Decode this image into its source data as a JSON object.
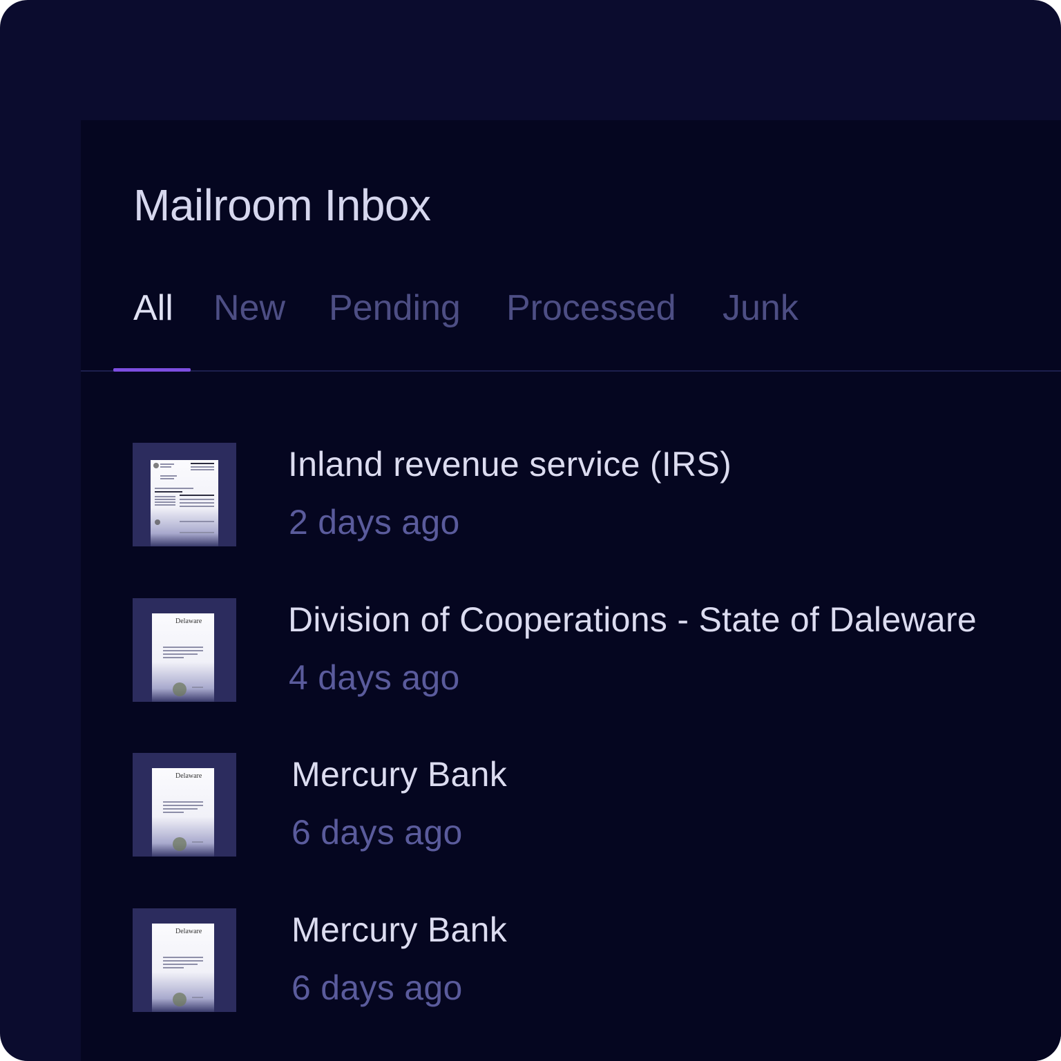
{
  "inbox": {
    "title": "Mailroom Inbox",
    "tabs": [
      {
        "label": "All",
        "active": true
      },
      {
        "label": "New",
        "active": false
      },
      {
        "label": "Pending",
        "active": false
      },
      {
        "label": "Processed",
        "active": false
      },
      {
        "label": "Junk",
        "active": false
      }
    ],
    "items": [
      {
        "sender": "Inland revenue service (IRS)",
        "date": "2 days ago",
        "thumbnail": "irs-document"
      },
      {
        "sender": "Division of Cooperations - State of Daleware",
        "date": "4 days ago",
        "thumbnail": "delaware-certificate"
      },
      {
        "sender": "Mercury Bank",
        "date": "6 days ago",
        "thumbnail": "delaware-certificate"
      },
      {
        "sender": "Mercury Bank",
        "date": "6 days ago",
        "thumbnail": "delaware-certificate"
      }
    ]
  },
  "colors": {
    "outer_background": "#0b0c2e",
    "panel_background": "#050620",
    "accent": "#7d4ee0",
    "text_primary": "#dcdcf0",
    "text_muted": "#5a5b9c"
  }
}
